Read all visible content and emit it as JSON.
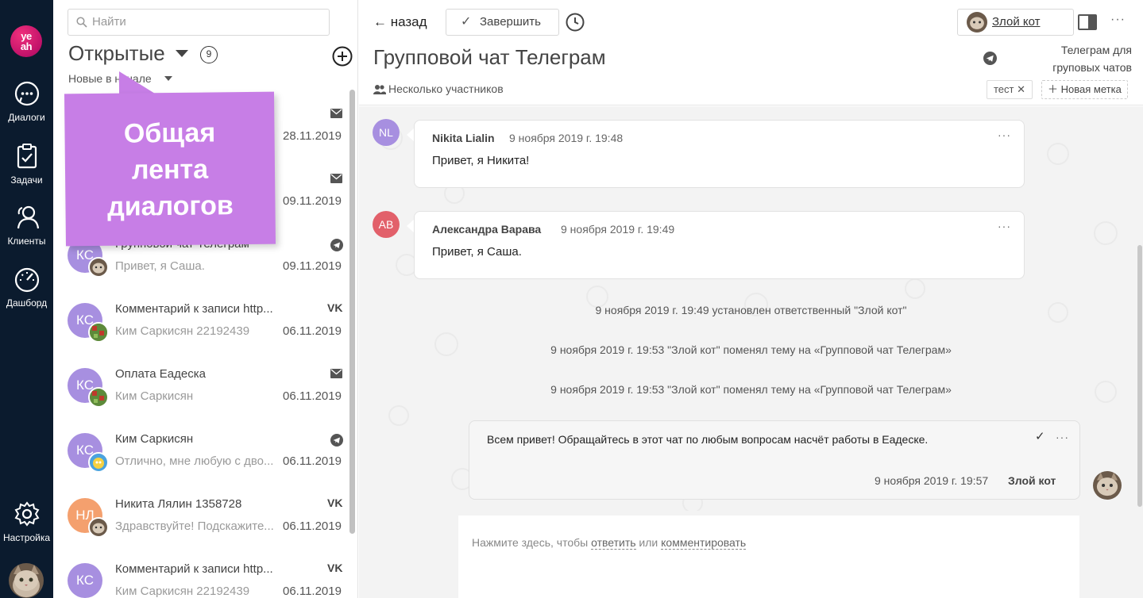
{
  "nav": {
    "logo": "ye\nah",
    "items": [
      {
        "label": "Диалоги",
        "icon": "chat-bubble-icon"
      },
      {
        "label": "Задачи",
        "icon": "clipboard-check-icon"
      },
      {
        "label": "Клиенты",
        "icon": "users-icon"
      },
      {
        "label": "Дашборд",
        "icon": "speedometer-icon"
      },
      {
        "label": "Настройка",
        "icon": "gear-icon"
      }
    ]
  },
  "list": {
    "search_placeholder": "Найти",
    "filter_title": "Открытые",
    "count": "9",
    "sort_label": "Новые в начале",
    "callout_text": "Общая лента диалогов",
    "conversations": [
      {
        "title": "",
        "preview": "",
        "date": "28.11.2019",
        "channel": "mail",
        "avatar_text": "",
        "avatar_color": "#ffffff"
      },
      {
        "title": "",
        "preview": "",
        "date": "09.11.2019",
        "channel": "mail",
        "avatar_text": "",
        "avatar_color": "#ffffff"
      },
      {
        "title": "Групповой чат Телеграм",
        "preview": "Привет, я Саша.",
        "date": "09.11.2019",
        "channel": "telegram",
        "avatar_text": "КС",
        "avatar_color": "#a78fe0"
      },
      {
        "title": "Комментарий к записи http...",
        "preview": "Ким Саркисян 22192439",
        "date": "06.11.2019",
        "channel": "vk",
        "avatar_text": "КС",
        "avatar_color": "#a78fe0"
      },
      {
        "title": "Оплата Еадеска",
        "preview": "Ким Саркисян",
        "date": "06.11.2019",
        "channel": "mail",
        "avatar_text": "КС",
        "avatar_color": "#a78fe0"
      },
      {
        "title": "Ким Саркисян",
        "preview": "Отлично, мне любую с дво...",
        "date": "06.11.2019",
        "channel": "telegram",
        "avatar_text": "КС",
        "avatar_color": "#a78fe0"
      },
      {
        "title": "Никита Лялин 1358728",
        "preview": "Здравствуйте! Подскажите...",
        "date": "06.11.2019",
        "channel": "vk",
        "avatar_text": "НЛ",
        "avatar_color": "#f4a06e"
      },
      {
        "title": "Комментарий к записи http...",
        "preview": "Ким Саркисян 22192439",
        "date": "06.11.2019",
        "channel": "vk",
        "avatar_text": "КС",
        "avatar_color": "#a78fe0"
      }
    ]
  },
  "chat": {
    "back_label": "← назад",
    "finish_label": "Завершить",
    "title": "Групповой чат Телеграм",
    "participants": "Несколько участников",
    "assignee": "Злой кот",
    "channel_name": "Телеграм для груповых чатов",
    "tag": "тест",
    "new_tag_label": "Новая метка",
    "messages": [
      {
        "avatar": "NL",
        "avatar_color": "#a78fe0",
        "author": "Nikita Lialin",
        "time": "9 ноября 2019 г. 19:48",
        "text": "Привет, я Никита!"
      },
      {
        "avatar": "AB",
        "avatar_color": "#e2606a",
        "author": "Александра Варава",
        "time": "9 ноября 2019 г. 19:49",
        "text": "Привет, я Саша."
      }
    ],
    "system_events": [
      "9 ноября 2019 г. 19:49 установлен ответственный \"Злой кот\"",
      "9 ноября 2019 г. 19:53 \"Злой кот\" поменял тему на «Групповой чат Телеграм»",
      "9 ноября 2019 г. 19:53 \"Злой кот\" поменял тему на «Групповой чат Телеграм»"
    ],
    "outgoing": {
      "text": "Всем привет! Обращайтесь в этот чат по любым вопросам насчёт работы в Еадеске.",
      "time": "9 ноября 2019 г. 19:57",
      "author": "Злой кот"
    },
    "composer": {
      "hint_prefix": "Нажмите здесь, чтобы",
      "reply_link": "ответить",
      "or": "или",
      "comment_link": "комментировать"
    }
  }
}
